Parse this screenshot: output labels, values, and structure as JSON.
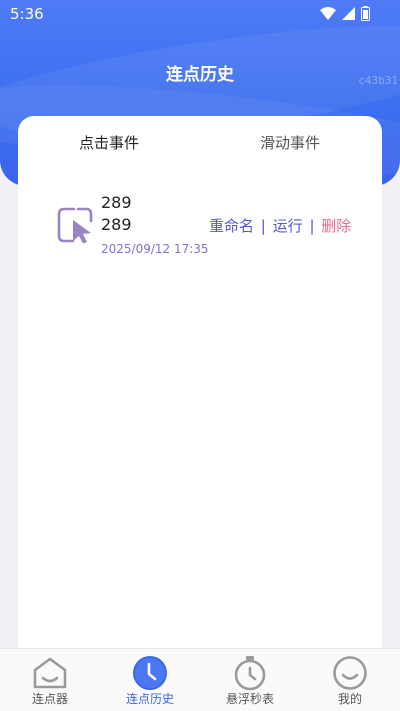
{
  "status_bar": {
    "time": "5:36"
  },
  "header": {
    "title": "连点历史",
    "watermark": "c43b31"
  },
  "tabs": [
    {
      "label": "点击事件",
      "active": true
    },
    {
      "label": "滑动事件",
      "active": false
    }
  ],
  "events": [
    {
      "icon": "cursor-click-icon",
      "name_line1": "289",
      "name_line2": "289",
      "date": "2025/09/12 17:35",
      "actions": {
        "rename": "重命名",
        "separator": "|",
        "run": "运行",
        "delete": "删除"
      }
    }
  ],
  "bottom_nav": [
    {
      "label": "连点器",
      "icon": "home-face-icon",
      "active": false
    },
    {
      "label": "连点历史",
      "icon": "clock-icon",
      "active": true
    },
    {
      "label": "悬浮秒表",
      "icon": "stopwatch-icon",
      "active": false
    },
    {
      "label": "我的",
      "icon": "smiley-face-icon",
      "active": false
    }
  ],
  "colors": {
    "header_blue": "#3c6ff0",
    "accent_purple": "#5a55d2",
    "delete_pink": "#f06b8c",
    "nav_active": "#3a66ea",
    "nav_inactive": "#9a9a9a"
  }
}
